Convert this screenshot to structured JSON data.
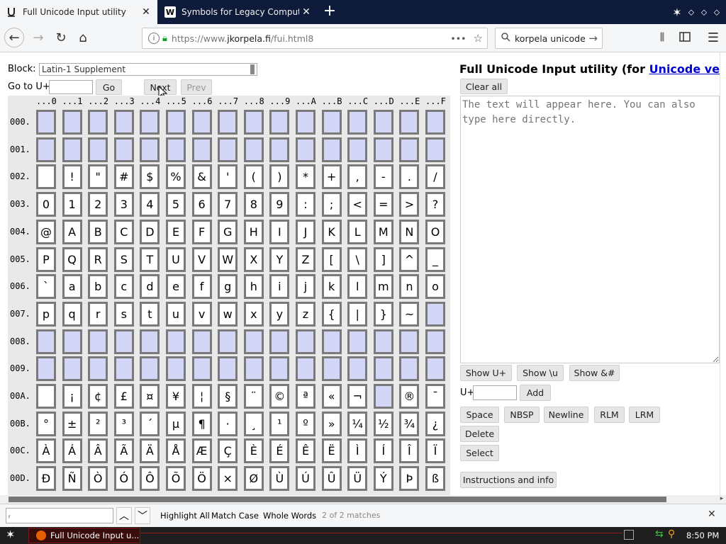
{
  "browser": {
    "tabs": [
      {
        "title": "Full Unicode Input utility",
        "icon": "unicode-u-icon"
      },
      {
        "title": "Symbols for Legacy Computing - W",
        "icon": "wikipedia-w-icon"
      }
    ],
    "url_prefix": "https://www.",
    "url_host": "jkorpela.fi",
    "url_path": "/fui.html8",
    "search_value": "korpela unicode",
    "page_actions": "•••"
  },
  "controls": {
    "block_label": "Block:",
    "block_value": "Latin-1 Supplement",
    "goto_label": "Go to U+",
    "goto_value": "",
    "go": "Go",
    "next": "Next",
    "prev": "Prev"
  },
  "grid": {
    "col_headers": [
      "...0",
      "...1",
      "...2",
      "...3",
      "...4",
      "...5",
      "...6",
      "...7",
      "...8",
      "...9",
      "...A",
      "...B",
      "...C",
      "...D",
      "...E",
      "...F"
    ],
    "rows": [
      {
        "label": "000.",
        "chars": [
          "",
          "",
          "",
          "",
          "",
          "",
          "",
          "",
          "",
          "",
          "",
          "",
          "",
          "",
          "",
          ""
        ]
      },
      {
        "label": "001.",
        "chars": [
          "",
          "",
          "",
          "",
          "",
          "",
          "",
          "",
          "",
          "",
          "",
          "",
          "",
          "",
          "",
          ""
        ]
      },
      {
        "label": "002.",
        "chars": [
          " ",
          "!",
          "\"",
          "#",
          "$",
          "%",
          "&",
          "'",
          "(",
          ")",
          "*",
          "+",
          ",",
          "-",
          ".",
          "/"
        ]
      },
      {
        "label": "003.",
        "chars": [
          "0",
          "1",
          "2",
          "3",
          "4",
          "5",
          "6",
          "7",
          "8",
          "9",
          ":",
          ";",
          "<",
          "=",
          ">",
          "?"
        ]
      },
      {
        "label": "004.",
        "chars": [
          "@",
          "A",
          "B",
          "C",
          "D",
          "E",
          "F",
          "G",
          "H",
          "I",
          "J",
          "K",
          "L",
          "M",
          "N",
          "O"
        ]
      },
      {
        "label": "005.",
        "chars": [
          "P",
          "Q",
          "R",
          "S",
          "T",
          "U",
          "V",
          "W",
          "X",
          "Y",
          "Z",
          "[",
          "\\",
          "]",
          "^",
          "_"
        ]
      },
      {
        "label": "006.",
        "chars": [
          "`",
          "a",
          "b",
          "c",
          "d",
          "e",
          "f",
          "g",
          "h",
          "i",
          "j",
          "k",
          "l",
          "m",
          "n",
          "o"
        ]
      },
      {
        "label": "007.",
        "chars": [
          "p",
          "q",
          "r",
          "s",
          "t",
          "u",
          "v",
          "w",
          "x",
          "y",
          "z",
          "{",
          "|",
          "}",
          "~",
          ""
        ]
      },
      {
        "label": "008.",
        "chars": [
          "",
          "",
          "",
          "",
          "",
          "",
          "",
          "",
          "",
          "",
          "",
          "",
          "",
          "",
          "",
          ""
        ]
      },
      {
        "label": "009.",
        "chars": [
          "",
          "",
          "",
          "",
          "",
          "",
          "",
          "",
          "",
          "",
          "",
          "",
          "",
          "",
          "",
          ""
        ]
      },
      {
        "label": "00A.",
        "chars": [
          " ",
          "¡",
          "¢",
          "£",
          "¤",
          "¥",
          "¦",
          "§",
          "¨",
          "©",
          "ª",
          "«",
          "¬",
          "",
          "®",
          "¯"
        ]
      },
      {
        "label": "00B.",
        "chars": [
          "°",
          "±",
          "²",
          "³",
          "´",
          "µ",
          "¶",
          "·",
          "¸",
          "¹",
          "º",
          "»",
          "¼",
          "½",
          "¾",
          "¿"
        ]
      },
      {
        "label": "00C.",
        "chars": [
          "À",
          "Á",
          "Â",
          "Ã",
          "Ä",
          "Å",
          "Æ",
          "Ç",
          "È",
          "É",
          "Ê",
          "Ë",
          "Ì",
          "Í",
          "Î",
          "Ï"
        ]
      },
      {
        "label": "00D.",
        "chars": [
          "Đ",
          "Ñ",
          "Ò",
          "Ó",
          "Ô",
          "Õ",
          "Ö",
          "×",
          "Ø",
          "Ù",
          "Ú",
          "Û",
          "Ü",
          "Ý",
          "Þ",
          "ß"
        ]
      }
    ]
  },
  "right": {
    "title_prefix": "Full Unicode Input utility (for ",
    "title_link": "Unicode version",
    "clear_all": "Clear all",
    "textarea_placeholder": "The text will appear here. You can also type here directly.",
    "show_u": "Show U+",
    "show_backslash_u": "Show \\u",
    "show_entity": "Show &#",
    "uplus_label": "U+",
    "uplus_value": "",
    "add": "Add",
    "space": "Space",
    "nbsp": "NBSP",
    "newline": "Newline",
    "rlm": "RLM",
    "lrm": "LRM",
    "delete": "Delete",
    "select": "Select",
    "instructions": "Instructions and info"
  },
  "findbar": {
    "value": "ᵣ",
    "highlight_all": "Highlight All",
    "match_case": "Match Case",
    "whole_words": "Whole Words",
    "matches": "2 of 2 matches"
  },
  "taskbar": {
    "window_title": "Full Unicode Input u...",
    "clock": "8:50 PM"
  },
  "colors": {
    "empty_cell": "#d4d6f8",
    "tabbar_bg": "#0d1a3a",
    "link": "#0000cc"
  }
}
